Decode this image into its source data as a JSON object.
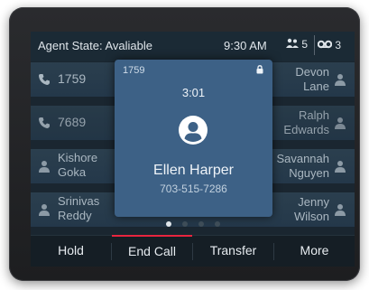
{
  "status_bar": {
    "agent_state": "Agent State: Avaliable",
    "time": "9:30 AM",
    "users_count": "5",
    "voicemail_count": "3"
  },
  "contacts": [
    {
      "left_text": "1759",
      "left_icon": "phone-icon",
      "right_line1": "Devon",
      "right_line2": "Lane"
    },
    {
      "left_text": "7689",
      "left_icon": "phone-icon",
      "right_line1": "Ralph",
      "right_line2": "Edwards"
    },
    {
      "left_line1": "Kishore",
      "left_line2": "Goka",
      "left_icon": "person-icon",
      "right_line1": "Savannah",
      "right_line2": "Nguyen"
    },
    {
      "left_line1": "Srinivas",
      "left_line2": "Reddy",
      "left_icon": "person-icon",
      "right_line1": "Jenny",
      "right_line2": "Wilson"
    }
  ],
  "call_popup": {
    "line": "1759",
    "duration": "3:01",
    "caller_name": "Ellen Harper",
    "caller_number": "703-515-7286"
  },
  "pagination": {
    "pages": 4,
    "active": 1
  },
  "softkeys": [
    "Hold",
    "End Call",
    "Transfer",
    "More"
  ],
  "colors": {
    "accent": "#e8253f",
    "popup_bg": "#3d6186",
    "screen_bg": "#1a2630"
  }
}
